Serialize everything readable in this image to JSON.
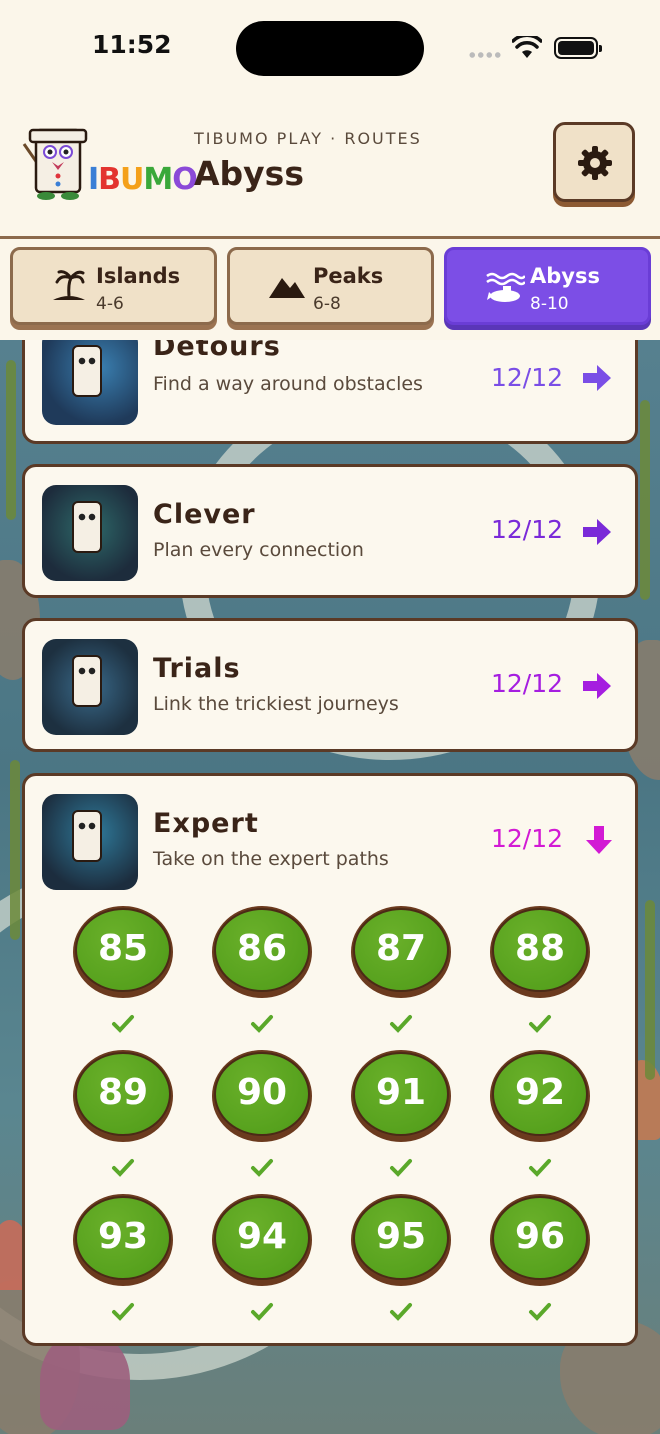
{
  "status_bar": {
    "time": "11:52"
  },
  "header": {
    "logo_text": "IBUMO",
    "subtitle": "TIBUMO PLAY · ROUTES",
    "title": "Abyss",
    "settings_icon": "gear-icon"
  },
  "tabs": [
    {
      "label": "Islands",
      "range": "4-6",
      "icon": "palm-island-icon",
      "active": false
    },
    {
      "label": "Peaks",
      "range": "6-8",
      "icon": "mountain-icon",
      "active": false
    },
    {
      "label": "Abyss",
      "range": "8-10",
      "icon": "submarine-icon",
      "active": true
    }
  ],
  "routes": [
    {
      "name": "Detours",
      "description": "Find a way around obstacles",
      "progress": "12/12",
      "color": "#7a4ee6",
      "arrow": "right-arrow-icon"
    },
    {
      "name": "Clever",
      "description": "Plan every connection",
      "progress": "12/12",
      "color": "#7a2ad8",
      "arrow": "right-arrow-icon"
    },
    {
      "name": "Trials",
      "description": "Link the trickiest journeys",
      "progress": "12/12",
      "color": "#a51ee0",
      "arrow": "right-arrow-icon"
    },
    {
      "name": "Expert",
      "description": "Take on the expert paths",
      "progress": "12/12",
      "color": "#d21ad4",
      "arrow": "down-arrow-icon"
    }
  ],
  "levels": [
    {
      "number": "85",
      "completed": true
    },
    {
      "number": "86",
      "completed": true
    },
    {
      "number": "87",
      "completed": true
    },
    {
      "number": "88",
      "completed": true
    },
    {
      "number": "89",
      "completed": true
    },
    {
      "number": "90",
      "completed": true
    },
    {
      "number": "91",
      "completed": true
    },
    {
      "number": "92",
      "completed": true
    },
    {
      "number": "93",
      "completed": true
    },
    {
      "number": "94",
      "completed": true
    },
    {
      "number": "95",
      "completed": true
    },
    {
      "number": "96",
      "completed": true
    }
  ],
  "colors": {
    "tab_active": "#7c4ee6",
    "level_green": "#56a11d",
    "check_green": "#5aa82a"
  }
}
